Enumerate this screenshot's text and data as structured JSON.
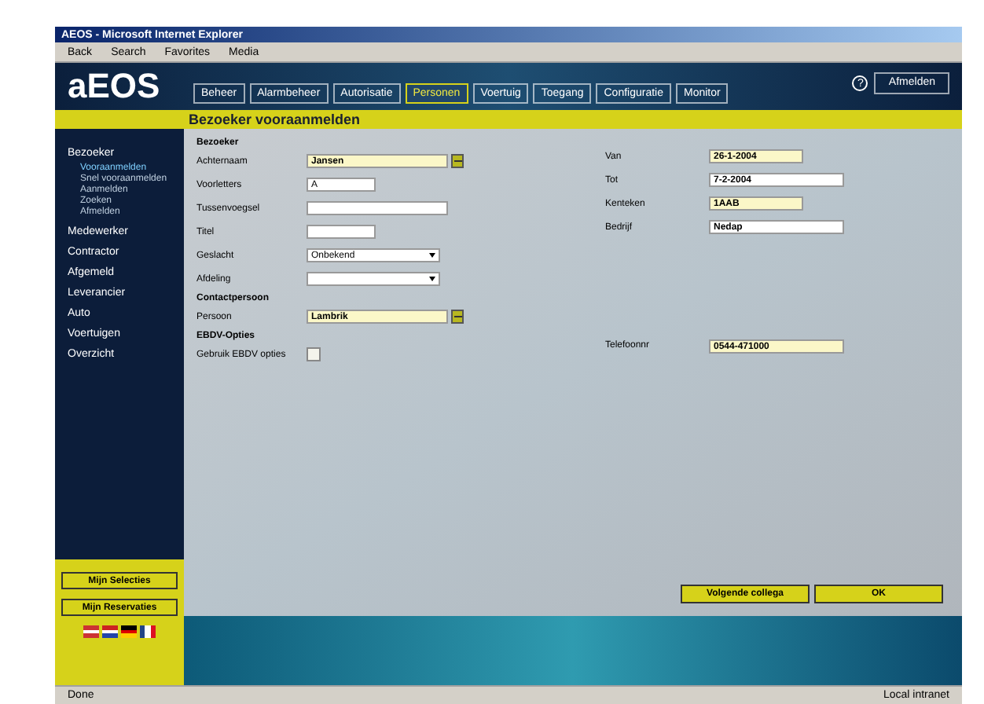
{
  "window": {
    "title": "AEOS - Microsoft Internet Explorer"
  },
  "toolbar": [
    "Back",
    "Search",
    "Favorites",
    "Media"
  ],
  "header": {
    "logo": "aEOS",
    "help": "?",
    "logout": "Afmelden"
  },
  "tabs": [
    {
      "label": "Beheer",
      "selected": false
    },
    {
      "label": "Alarmbeheer",
      "selected": false
    },
    {
      "label": "Autorisatie",
      "selected": false
    },
    {
      "label": "Personen",
      "selected": true
    },
    {
      "label": "Voertuig",
      "selected": false
    },
    {
      "label": "Toegang",
      "selected": false
    },
    {
      "label": "Configuratie",
      "selected": false
    },
    {
      "label": "Monitor",
      "selected": false
    }
  ],
  "page_title": "Bezoeker vooraanmelden",
  "sidebar": {
    "items": [
      {
        "label": "Bezoeker",
        "children": [
          {
            "label": "Vooraanmelden",
            "selected": true
          },
          {
            "label": "Snel vooraanmelden",
            "selected": false
          },
          {
            "label": "Aanmelden",
            "selected": false
          },
          {
            "label": "Zoeken",
            "selected": false
          },
          {
            "label": "Afmelden",
            "selected": false
          }
        ]
      },
      {
        "label": "Medewerker"
      },
      {
        "label": "Contractor"
      },
      {
        "label": "Afgemeld"
      },
      {
        "label": "Leverancier"
      },
      {
        "label": "Auto"
      },
      {
        "label": "Voertuigen"
      },
      {
        "label": "Overzicht"
      }
    ],
    "buttons": [
      "Mijn Selecties",
      "Mijn Reservaties"
    ]
  },
  "form": {
    "sections": [
      {
        "title": "Bezoeker",
        "fields": [
          {
            "kind": "lookup",
            "label": "Achternaam",
            "value": "Jansen",
            "required": true
          },
          {
            "kind": "text",
            "label": "Voorletters",
            "value": "A"
          },
          {
            "kind": "longtext",
            "label": "Tussenvoegsel"
          },
          {
            "kind": "text",
            "label": "Titel"
          },
          {
            "kind": "select",
            "label": "Geslacht",
            "value": "Onbekend"
          },
          {
            "kind": "select",
            "label": "Afdeling"
          }
        ]
      },
      {
        "title": "Contactpersoon",
        "fields": [
          {
            "kind": "lookup",
            "label": "Persoon",
            "value": "Lambrik",
            "required": true
          }
        ]
      },
      {
        "title": "EBDV-Opties",
        "fields": [
          {
            "kind": "checkbox",
            "label": "Gebruik EBDV opties",
            "checked": false
          }
        ]
      }
    ],
    "right_fields": [
      {
        "label": "Van",
        "value": "26-1-2004",
        "required": true
      },
      {
        "label": "Tot",
        "value": "7-2-2004",
        "required": false
      },
      {
        "label": "Kenteken",
        "value": "1AAB",
        "required": true
      },
      {
        "label": "Bedrijf",
        "value": "Nedap",
        "required": false
      }
    ],
    "phone": {
      "label": "Telefoonnr",
      "value": "0544-471000"
    },
    "buttons": [
      "Volgende collega",
      "OK"
    ]
  },
  "status_bar": {
    "text": "Done",
    "zone": "Local intranet"
  }
}
